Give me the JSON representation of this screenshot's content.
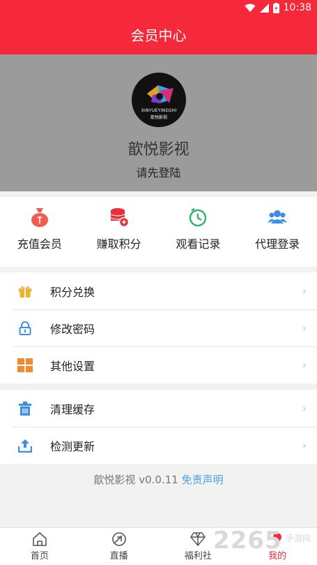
{
  "status_bar": {
    "time": "10:38"
  },
  "header": {
    "title": "会员中心"
  },
  "profile": {
    "logo_text": "XINYUEYINGSHI",
    "logo_sub": "歆悦影视",
    "app_name": "歆悦影视",
    "login_prompt": "请先登陆"
  },
  "quick_actions": [
    {
      "label": "充值会员",
      "icon": "money-bag-icon",
      "color": "#f45b4f"
    },
    {
      "label": "赚取积分",
      "icon": "coins-icon",
      "color": "#e8303a"
    },
    {
      "label": "观看记录",
      "icon": "clock-icon",
      "color": "#2fb36a"
    },
    {
      "label": "代理登录",
      "icon": "people-icon",
      "color": "#3b8ee8"
    }
  ],
  "menu_group_1": [
    {
      "label": "积分兑换",
      "icon": "gift-icon"
    },
    {
      "label": "修改密码",
      "icon": "lock-icon"
    },
    {
      "label": "其他设置",
      "icon": "grid-icon"
    }
  ],
  "menu_group_2": [
    {
      "label": "清理缓存",
      "icon": "trash-icon"
    },
    {
      "label": "检测更新",
      "icon": "upload-icon"
    }
  ],
  "footer": {
    "version_text": "歆悦影视 v0.0.11",
    "disclaimer": "免责声明"
  },
  "tabs": [
    {
      "label": "首页",
      "icon": "home-icon"
    },
    {
      "label": "直播",
      "icon": "live-icon"
    },
    {
      "label": "福利社",
      "icon": "diamond-icon"
    },
    {
      "label": "我的",
      "icon": "profile-icon",
      "active": true
    }
  ],
  "watermark": {
    "text": "2265",
    "sub": "手游网"
  }
}
